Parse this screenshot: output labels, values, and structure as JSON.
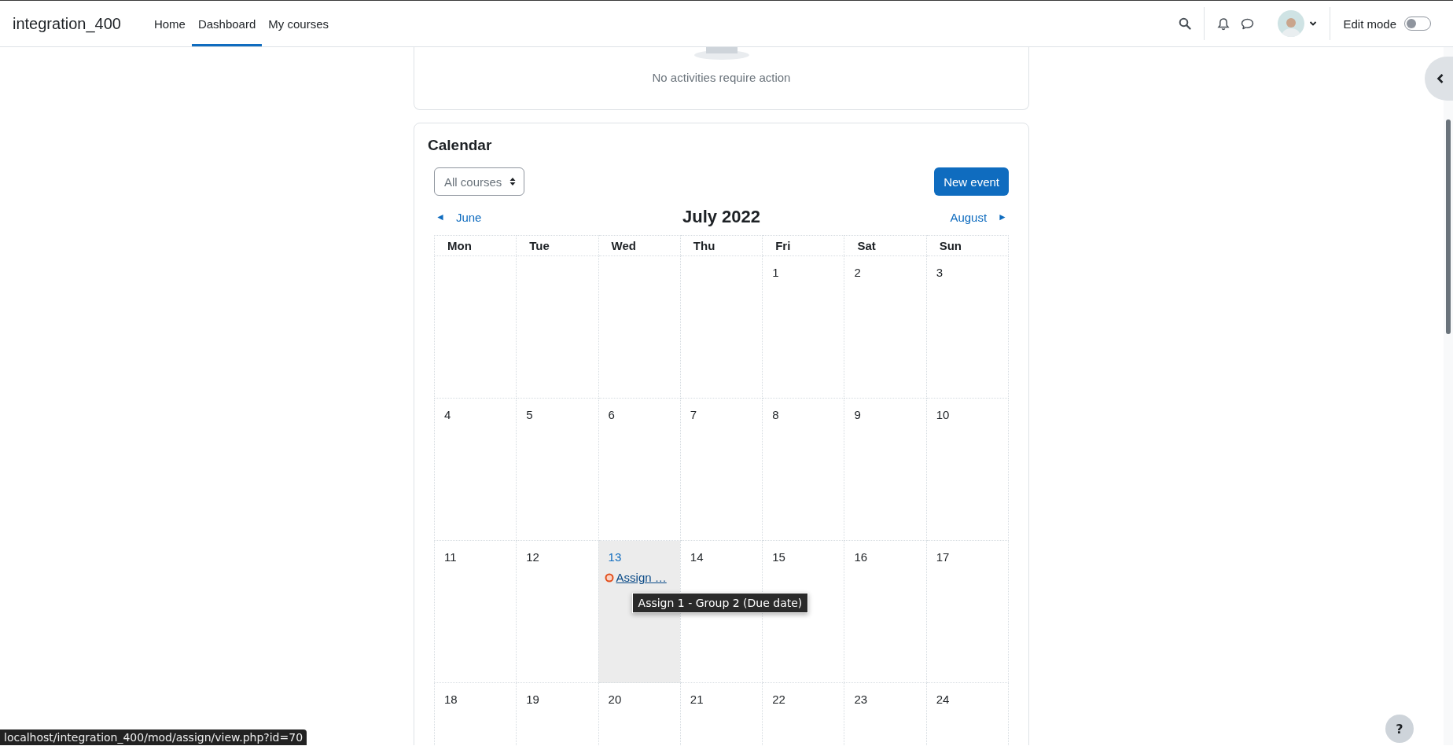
{
  "navbar": {
    "brand": "integration_400",
    "links": [
      {
        "label": "Home",
        "selected": false
      },
      {
        "label": "Dashboard",
        "selected": true
      },
      {
        "label": "My courses",
        "selected": false
      }
    ],
    "edit_mode": {
      "label": "Edit mode",
      "on": false
    }
  },
  "timeline": {
    "empty_message": "No activities require action"
  },
  "calendar": {
    "title": "Calendar",
    "course_filter": "All courses",
    "new_event_button": "New event",
    "prev_month": {
      "arrow": "◄",
      "label": "June"
    },
    "month_title": "July 2022",
    "next_month": {
      "label": "August",
      "arrow": "►"
    },
    "weekdays": [
      "Mon",
      "Tue",
      "Wed",
      "Thu",
      "Fri",
      "Sat",
      "Sun"
    ],
    "weeks": [
      [
        {
          "kind": "empty"
        },
        {
          "kind": "empty"
        },
        {
          "kind": "empty"
        },
        {
          "kind": "empty"
        },
        {
          "kind": "day",
          "day": "1",
          "today": false
        },
        {
          "kind": "day",
          "day": "2",
          "today": false
        },
        {
          "kind": "day",
          "day": "3",
          "today": false
        }
      ],
      [
        {
          "kind": "day",
          "day": "4",
          "today": false
        },
        {
          "kind": "day",
          "day": "5",
          "today": false
        },
        {
          "kind": "day",
          "day": "6",
          "today": false
        },
        {
          "kind": "day",
          "day": "7",
          "today": false
        },
        {
          "kind": "day",
          "day": "8",
          "today": false
        },
        {
          "kind": "day",
          "day": "9",
          "today": false
        },
        {
          "kind": "day",
          "day": "10",
          "today": false
        }
      ],
      [
        {
          "kind": "day",
          "day": "11",
          "today": false
        },
        {
          "kind": "day",
          "day": "12",
          "today": false
        },
        {
          "kind": "day",
          "day": "13",
          "today": true,
          "events": [
            {
              "label": "Assign …",
              "tooltip": "Assign 1 - Group 2 (Due date)"
            }
          ]
        },
        {
          "kind": "day",
          "day": "14",
          "today": false
        },
        {
          "kind": "day",
          "day": "15",
          "today": false
        },
        {
          "kind": "day",
          "day": "16",
          "today": false
        },
        {
          "kind": "day",
          "day": "17",
          "today": false
        }
      ],
      [
        {
          "kind": "day",
          "day": "18",
          "today": false
        },
        {
          "kind": "day",
          "day": "19",
          "today": false
        },
        {
          "kind": "day",
          "day": "20",
          "today": false
        },
        {
          "kind": "day",
          "day": "21",
          "today": false
        },
        {
          "kind": "day",
          "day": "22",
          "today": false
        },
        {
          "kind": "day",
          "day": "23",
          "today": false
        },
        {
          "kind": "day",
          "day": "24",
          "today": false
        }
      ]
    ]
  },
  "help_button": "?",
  "status_url": "localhost/integration_400/mod/assign/view.php?id=70"
}
